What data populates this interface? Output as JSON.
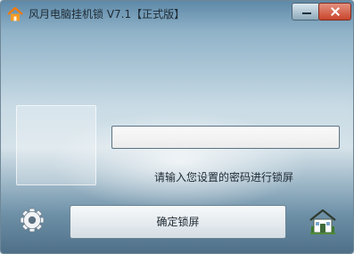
{
  "window": {
    "title": "风月电脑挂机锁 V7.1【正式版】",
    "app_icon": "house-icon",
    "controls": {
      "minimize": "minimize-icon",
      "close": "close-icon"
    }
  },
  "lock_screen": {
    "password_value": "",
    "password_placeholder": "",
    "hint": "请输入您设置的密码进行锁屏",
    "confirm_label": "确定锁屏",
    "settings_icon": "gear-icon",
    "home_icon": "home-icon"
  },
  "colors": {
    "accent_close": "#c9452c",
    "text": "#1f2a33"
  }
}
